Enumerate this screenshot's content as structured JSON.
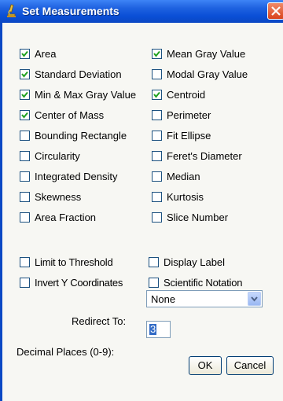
{
  "window": {
    "title": "Set Measurements"
  },
  "measurements": [
    {
      "label": "Area",
      "checked": true
    },
    {
      "label": "Mean Gray Value",
      "checked": true
    },
    {
      "label": "Standard Deviation",
      "checked": true
    },
    {
      "label": "Modal Gray Value",
      "checked": false
    },
    {
      "label": "Min & Max Gray Value",
      "checked": true
    },
    {
      "label": "Centroid",
      "checked": true
    },
    {
      "label": "Center of Mass",
      "checked": true
    },
    {
      "label": "Perimeter",
      "checked": false
    },
    {
      "label": "Bounding Rectangle",
      "checked": false
    },
    {
      "label": "Fit Ellipse",
      "checked": false
    },
    {
      "label": "Circularity",
      "checked": false
    },
    {
      "label": "Feret's Diameter",
      "checked": false
    },
    {
      "label": "Integrated Density",
      "checked": false
    },
    {
      "label": "Median",
      "checked": false
    },
    {
      "label": "Skewness",
      "checked": false
    },
    {
      "label": "Kurtosis",
      "checked": false
    },
    {
      "label": "Area Fraction",
      "checked": false
    },
    {
      "label": "Slice Number",
      "checked": false
    }
  ],
  "options": [
    {
      "label": "Limit to Threshold",
      "checked": false
    },
    {
      "label": "Display Label",
      "checked": false
    },
    {
      "label": "Invert Y Coordinates",
      "checked": false
    },
    {
      "label": "Scientific Notation",
      "checked": false
    }
  ],
  "redirect": {
    "label": "Redirect To:",
    "value": "None"
  },
  "decimal": {
    "label": "Decimal Places (0-9):",
    "value": "3"
  },
  "buttons": {
    "ok": "OK",
    "cancel": "Cancel"
  }
}
